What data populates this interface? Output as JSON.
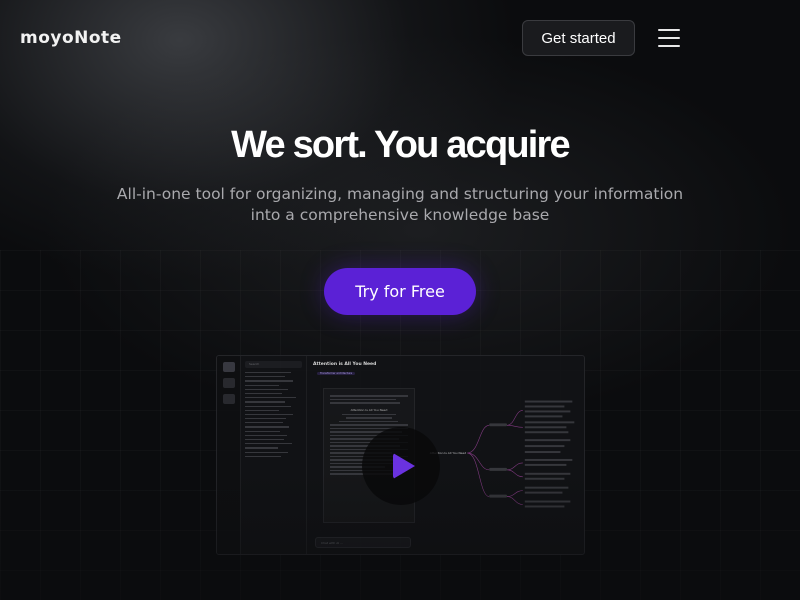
{
  "brand": {
    "name": "moyoNote"
  },
  "nav": {
    "get_started_label": "Get started",
    "menu_icon": "hamburger-menu-icon"
  },
  "hero": {
    "title": "We sort. You acquire",
    "subtitle": "All-in-one tool for organizing, managing  and structuring your information into a comprehensive knowledge base",
    "cta_label": "Try for Free"
  },
  "preview": {
    "search_placeholder": "Search",
    "doc_title": "Attention is All You Need",
    "doc_tag": "Transformer architecture",
    "doc_heading": "Attention Is All You Need",
    "input_placeholder": "Chat with AI ...",
    "map_root": "Attention Is All You Need",
    "play_icon": "play-icon"
  },
  "colors": {
    "accent": "#5b21d6",
    "background": "#0b0c0e",
    "map_lines": "#8a3e8a"
  }
}
